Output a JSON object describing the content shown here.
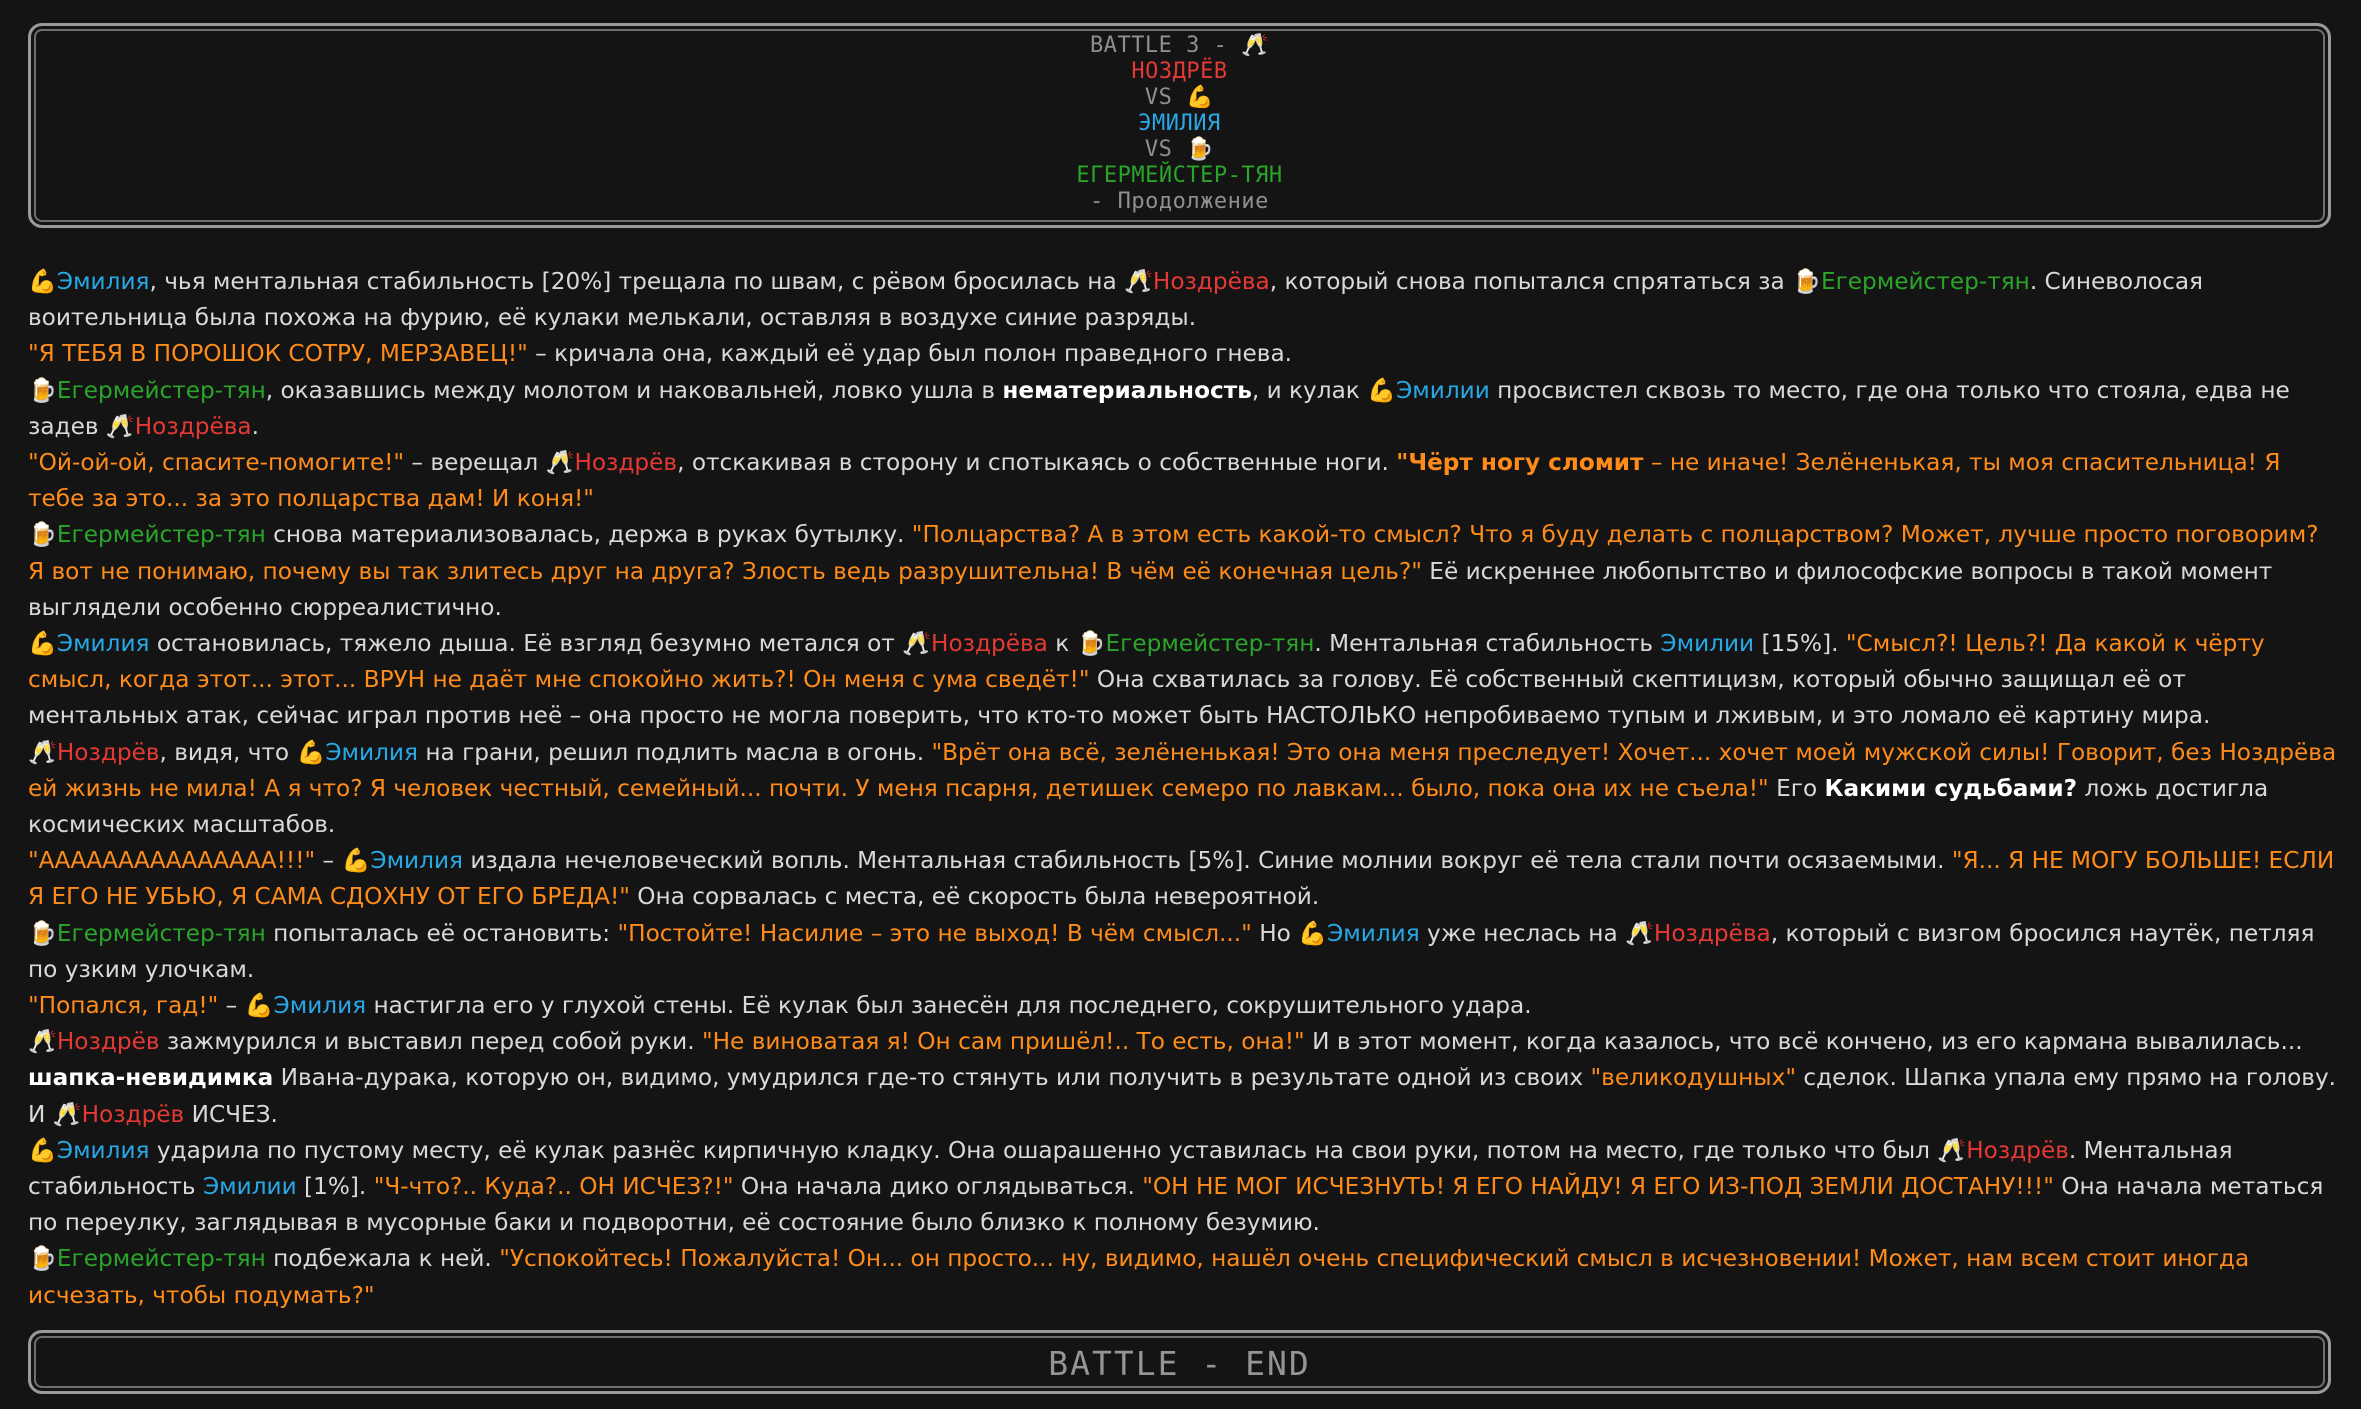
{
  "header": {
    "line1": "BATTLE 3 - ",
    "line1_icon": "🥂",
    "name1": "НОЗДРЁВ",
    "vs1": "VS ",
    "vs1_icon": "💪",
    "name2": "ЭМИЛИЯ",
    "vs2": "VS ",
    "vs2_icon": "🍺",
    "name3": "ЕГЕРМЕЙСТЕР-ТЯН",
    "subtitle": "- Продолжение"
  },
  "characters": {
    "nozdrev": {
      "icon": "🥂",
      "icon_name": "champagne-glasses-icon",
      "color": "#e53935"
    },
    "emilia": {
      "icon": "💪",
      "icon_name": "flexed-biceps-icon",
      "color": "#29a8e6"
    },
    "jager": {
      "icon": "🍺",
      "icon_name": "beer-mug-icon",
      "color": "#2aa52a"
    }
  },
  "colors": {
    "quote": "#ff8c1a",
    "text": "#d9d9d9",
    "bg": "#141414"
  },
  "paragraphs": [
    [
      [
        "i",
        "e"
      ],
      [
        "e",
        "Эмилия"
      ],
      [
        "t",
        ", чья ментальная стабильность [20%] трещала по швам, с рёвом бросилась на "
      ],
      [
        "i",
        "n"
      ],
      [
        "n",
        "Ноздрёва"
      ],
      [
        "t",
        ", который снова попытался спрятаться за "
      ],
      [
        "i",
        "j"
      ],
      [
        "j",
        "Егермейстер-тян"
      ],
      [
        "t",
        ". Синеволосая воительница была похожа на фурию, её кулаки мелькали, оставляя в воздухе синие разряды."
      ]
    ],
    [
      [
        "q",
        "\"Я ТЕБЯ В ПОРОШОК СОТРУ, МЕРЗАВЕЦ!\""
      ],
      [
        "t",
        " – кричала она, каждый её удар был полон праведного гнева."
      ]
    ],
    [
      [
        "i",
        "j"
      ],
      [
        "j",
        "Егермейстер-тян"
      ],
      [
        "t",
        ", оказавшись между молотом и наковальней, ловко ушла в "
      ],
      [
        "b",
        "нематериальность"
      ],
      [
        "t",
        ", и кулак "
      ],
      [
        "i",
        "e"
      ],
      [
        "e",
        "Эмилии"
      ],
      [
        "t",
        " просвистел сквозь то место, где она только что стояла, едва не задев "
      ],
      [
        "i",
        "n"
      ],
      [
        "n",
        "Ноздрёва"
      ],
      [
        "t",
        "."
      ]
    ],
    [
      [
        "q",
        "\"Ой-ой-ой, спасите-помогите!\""
      ],
      [
        "t",
        " – верещал "
      ],
      [
        "i",
        "n"
      ],
      [
        "n",
        "Ноздрёв"
      ],
      [
        "t",
        ", отскакивая в сторону и спотыкаясь о собственные ноги. "
      ],
      [
        "qb",
        "\"Чёрт ногу сломит"
      ],
      [
        "q",
        " – не иначе! Зелёненькая, ты моя спасительница! Я тебе за это... за это полцарства дам! И коня!\""
      ]
    ],
    [
      [
        "i",
        "j"
      ],
      [
        "j",
        "Егермейстер-тян"
      ],
      [
        "t",
        " снова материализовалась, держа в руках бутылку. "
      ],
      [
        "q",
        "\"Полцарства? А в этом есть какой-то смысл? Что я буду делать с полцарством? Может, лучше просто поговорим? Я вот не понимаю, почему вы так злитесь друг на друга? Злость ведь разрушительна! В чём её конечная цель?\""
      ],
      [
        "t",
        " Её искреннее любопытство и философские вопросы в такой момент выглядели особенно сюрреалистично."
      ]
    ],
    [
      [
        "i",
        "e"
      ],
      [
        "e",
        "Эмилия"
      ],
      [
        "t",
        " остановилась, тяжело дыша. Её взгляд безумно метался от "
      ],
      [
        "i",
        "n"
      ],
      [
        "n",
        "Ноздрёва"
      ],
      [
        "t",
        " к "
      ],
      [
        "i",
        "j"
      ],
      [
        "j",
        "Егермейстер-тян"
      ],
      [
        "t",
        ". Ментальная стабильность "
      ],
      [
        "e",
        "Эмилии"
      ],
      [
        "t",
        " [15%]. "
      ],
      [
        "q",
        "\"Смысл?! Цель?! Да какой к чёрту смысл, когда этот... этот... ВРУН не даёт мне спокойно жить?! Он меня с ума сведёт!\""
      ],
      [
        "t",
        " Она схватилась за голову. Её собственный скептицизм, который обычно защищал её от ментальных атак, сейчас играл против неё – она просто не могла поверить, что кто-то может быть НАСТОЛЬКО непробиваемо тупым и лживым, и это ломало её картину мира."
      ]
    ],
    [
      [
        "i",
        "n"
      ],
      [
        "n",
        "Ноздрёв"
      ],
      [
        "t",
        ", видя, что "
      ],
      [
        "i",
        "e"
      ],
      [
        "e",
        "Эмилия"
      ],
      [
        "t",
        " на грани, решил подлить масла в огонь. "
      ],
      [
        "q",
        "\"Врёт она всё, зелёненькая! Это она меня преследует! Хочет... хочет моей мужской силы! Говорит, без Ноздрёва ей жизнь не мила! А я что? Я человек честный, семейный... почти. У меня псарня, детишек семеро по лавкам... было, пока она их не съела!\""
      ],
      [
        "t",
        " Его "
      ],
      [
        "b",
        "Какими судьбами?"
      ],
      [
        "t",
        " ложь достигла космических масштабов."
      ]
    ],
    [
      [
        "q",
        "\"ААААААААААААААА!!!\""
      ],
      [
        "t",
        " – "
      ],
      [
        "i",
        "e"
      ],
      [
        "e",
        "Эмилия"
      ],
      [
        "t",
        " издала нечеловеческий вопль. Ментальная стабильность [5%]. Синие молнии вокруг её тела стали почти осязаемыми. "
      ],
      [
        "q",
        "\"Я... Я НЕ МОГУ БОЛЬШЕ! ЕСЛИ Я ЕГО НЕ УБЬЮ, Я САМА СДОХНУ ОТ ЕГО БРЕДА!\""
      ],
      [
        "t",
        " Она сорвалась с места, её скорость была невероятной."
      ]
    ],
    [
      [
        "i",
        "j"
      ],
      [
        "j",
        "Егермейстер-тян"
      ],
      [
        "t",
        " попыталась её остановить: "
      ],
      [
        "q",
        "\"Постойте! Насилие – это не выход! В чём смысл...\""
      ],
      [
        "t",
        " Но "
      ],
      [
        "i",
        "e"
      ],
      [
        "e",
        "Эмилия"
      ],
      [
        "t",
        " уже неслась на "
      ],
      [
        "i",
        "n"
      ],
      [
        "n",
        "Ноздрёва"
      ],
      [
        "t",
        ", который с визгом бросился наутёк, петляя по узким улочкам."
      ]
    ],
    [
      [
        "q",
        "\"Попался, гад!\""
      ],
      [
        "t",
        " – "
      ],
      [
        "i",
        "e"
      ],
      [
        "e",
        "Эмилия"
      ],
      [
        "t",
        " настигла его у глухой стены. Её кулак был занесён для последнего, сокрушительного удара."
      ]
    ],
    [
      [
        "i",
        "n"
      ],
      [
        "n",
        "Ноздрёв"
      ],
      [
        "t",
        " зажмурился и выставил перед собой руки. "
      ],
      [
        "q",
        "\"Не виноватая я! Он сам пришёл!.. То есть, она!\""
      ],
      [
        "t",
        " И в этот момент, когда казалось, что всё кончено, из его кармана вывалилась... "
      ],
      [
        "b",
        "шапка-невидимка"
      ],
      [
        "t",
        " Ивана-дурака, которую он, видимо, умудрился где-то стянуть или получить в результате одной из своих "
      ],
      [
        "q",
        "\"великодушных\""
      ],
      [
        "t",
        " сделок. Шапка упала ему прямо на голову."
      ]
    ],
    [
      [
        "t",
        "И "
      ],
      [
        "i",
        "n"
      ],
      [
        "n",
        "Ноздрёв"
      ],
      [
        "t",
        " ИСЧЕЗ."
      ]
    ],
    [
      [
        "i",
        "e"
      ],
      [
        "e",
        "Эмилия"
      ],
      [
        "t",
        " ударила по пустому месту, её кулак разнёс кирпичную кладку. Она ошарашенно уставилась на свои руки, потом на место, где только что был "
      ],
      [
        "i",
        "n"
      ],
      [
        "n",
        "Ноздрёв"
      ],
      [
        "t",
        ". Ментальная стабильность "
      ],
      [
        "e",
        "Эмилии"
      ],
      [
        "t",
        " [1%]. "
      ],
      [
        "q",
        "\"Ч-что?.. Куда?.. ОН ИСЧЕЗ?!\""
      ],
      [
        "t",
        " Она начала дико оглядываться. "
      ],
      [
        "q",
        "\"ОН НЕ МОГ ИСЧЕЗНУТЬ! Я ЕГО НАЙДУ! Я ЕГО ИЗ-ПОД ЗЕМЛИ ДОСТАНУ!!!\""
      ],
      [
        "t",
        " Она начала метаться по переулку, заглядывая в мусорные баки и подворотни, её состояние было близко к полному безумию."
      ]
    ],
    [
      [
        "i",
        "j"
      ],
      [
        "j",
        "Егермейстер-тян"
      ],
      [
        "t",
        " подбежала к ней. "
      ],
      [
        "q",
        "\"Успокойтесь! Пожалуйста! Он... он просто... ну, видимо, нашёл очень специфический смысл в исчезновении! Может, нам всем стоит иногда исчезать, чтобы подумать?\""
      ]
    ]
  ],
  "footer": {
    "text": "BATTLE - END"
  }
}
